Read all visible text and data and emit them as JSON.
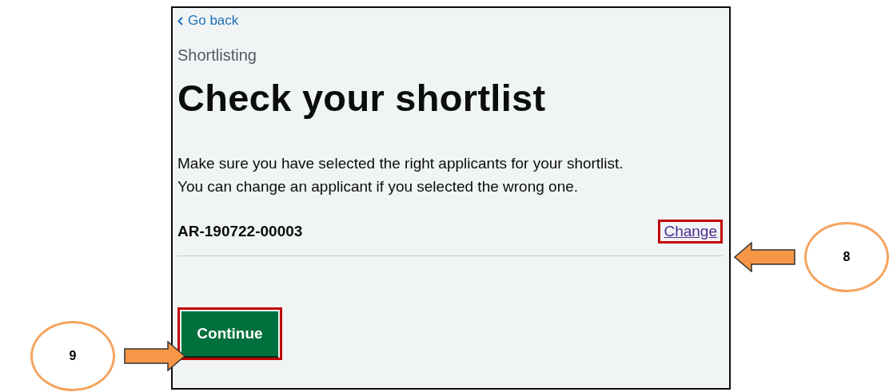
{
  "back_link": "Go back",
  "caption": "Shortlisting",
  "heading": "Check your shortlist",
  "intro": [
    "Make sure you have selected the right applicants for your shortlist.",
    "You can change an applicant if you selected the wrong one."
  ],
  "applicants": [
    {
      "reference": "AR-190722-00003",
      "action": "Change",
      "highlighted": true
    }
  ],
  "continue_button": {
    "label": "Continue",
    "highlighted": true
  },
  "annotations": [
    {
      "label": "8",
      "points_left": true
    },
    {
      "label": "9",
      "points_left": false
    }
  ]
}
